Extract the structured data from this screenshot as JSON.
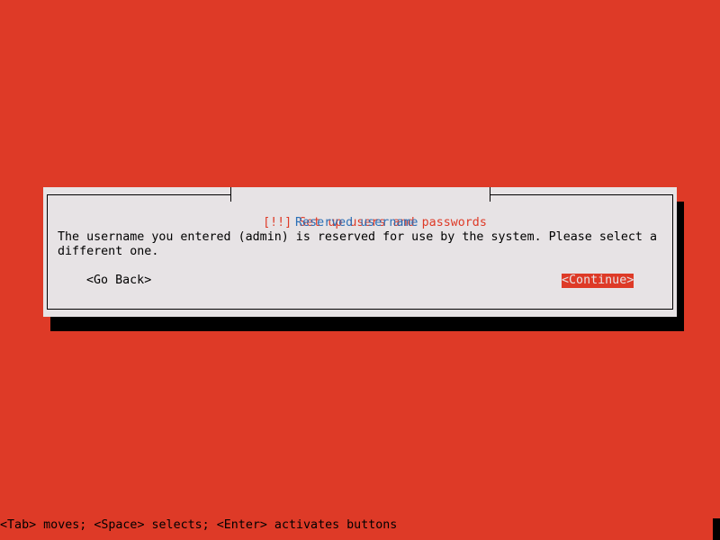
{
  "dialog": {
    "title": "[!!] Set up users and passwords",
    "heading": "Reserved username",
    "message": "The username you entered (admin) is reserved for use by the system. Please select a different one.",
    "buttons": {
      "go_back": "<Go Back>",
      "continue": "<Continue>"
    }
  },
  "status_bar": {
    "hint": "<Tab> moves; <Space> selects; <Enter> activates buttons"
  },
  "colors": {
    "background": "#de3a27",
    "dialog_background": "#e7e3e5",
    "heading": "#2b6fb6",
    "selected_button": "#de3a27",
    "shadow": "#000000"
  }
}
